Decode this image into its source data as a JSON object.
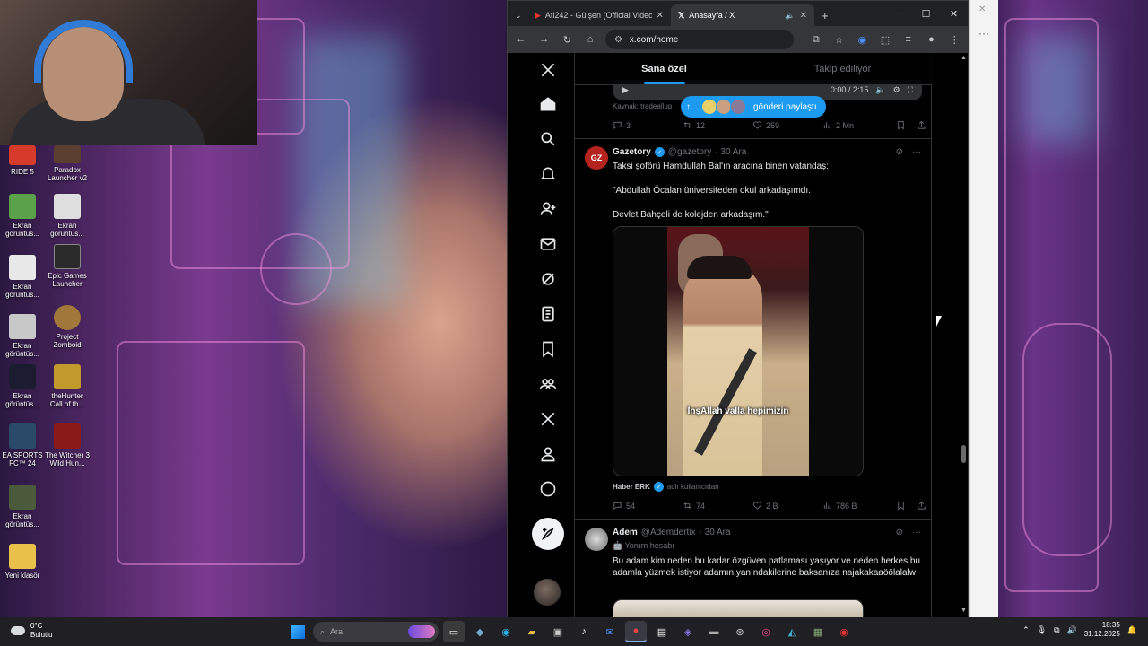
{
  "desktop": {
    "icons": [
      {
        "label": "RIDE 5",
        "color": "#d63a2a"
      },
      {
        "label": "Paradox Launcher v2",
        "color": "#c23b3b"
      },
      {
        "label": "Ekran görüntüs...",
        "color": "#5ba14a"
      },
      {
        "label": "Ekran görüntüs...",
        "color": "#dedede"
      },
      {
        "label": "Epic Games Launcher",
        "color": "#2a2a2a"
      },
      {
        "label": "Ekran görüntüs...",
        "color": "#e8e8e8"
      },
      {
        "label": "Ekran görüntüs...",
        "color": "#c8c8c8"
      },
      {
        "label": "Project Zomboid",
        "color": "#a0783a"
      },
      {
        "label": "Ekran görüntüs...",
        "color": "#1c1c30"
      },
      {
        "label": "theHunter Call of th...",
        "color": "#c29a2c"
      },
      {
        "label": "EA SPORTS FC™ 24",
        "color": "#2b4a6a"
      },
      {
        "label": "The Witcher 3 Wild Hun...",
        "color": "#8a1a1a"
      },
      {
        "label": "Ekran görüntüs...",
        "color": "#4a5a3a"
      },
      {
        "label": "Yeni klasör",
        "color": "#e8c04a"
      }
    ]
  },
  "browser": {
    "tabs": [
      {
        "label": "Atl242 - Gülşen (Official Video)"
      },
      {
        "label": "Anasayfa / X"
      }
    ],
    "new_tab": "+",
    "url": "x.com/home"
  },
  "x": {
    "header_tabs": {
      "for_you": "Sana özel",
      "following": "Takip ediliyor"
    },
    "video": {
      "time": "0:00 / 2:15"
    },
    "new_posts_pill": "gönderi paylaştı",
    "source_line": "Kaynak: tradeallup",
    "top_actions": {
      "replies": "3",
      "reposts": "12",
      "likes": "259",
      "views": "2 Mn"
    },
    "post1": {
      "name": "Gazetory",
      "handle": "@gazetory",
      "time": "· 30 Ara",
      "line1": "Taksi şoförü Hamdullah Bal'ın aracına binen vatandaş:",
      "line2": "\"Abdullah Öcalan üniversiteden okul arkadaşımdı.",
      "line3": "Devlet Bahçeli de kolejden arkadaşım.\"",
      "subtitle": "İnşAllah valla hepimizin",
      "via_name": "Haber ERK",
      "via_text": "adlı kullanıcıdan",
      "actions": {
        "replies": "54",
        "reposts": "74",
        "likes": "2 B",
        "views": "786 B"
      }
    },
    "post2": {
      "name": "Adem",
      "handle": "@Ademdertix",
      "time": "· 30 Ara",
      "tag": "Yorum hesabı",
      "text": "Bu adam kim neden bu kadar özgüven patlaması yaşıyor ve neden herkes bu adamla yüzmek istiyor adamın yanındakilerine baksanıza najakakaaöölalalw"
    }
  },
  "taskbar": {
    "temp": "0°C",
    "weather": "Bulutlu",
    "search_placeholder": "Ara",
    "time": "18:35",
    "date": "31.12.2025"
  }
}
